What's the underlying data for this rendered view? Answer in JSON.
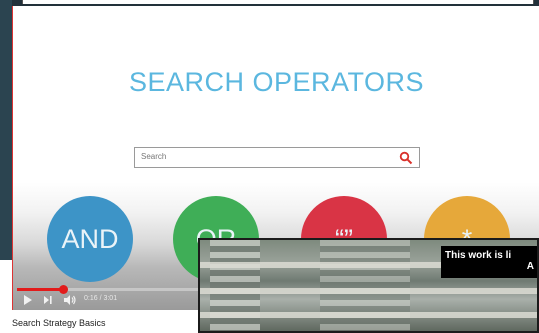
{
  "slide": {
    "title": "SEARCH OPERATORS",
    "search_placeholder": "Search",
    "operators": [
      "AND",
      "OR",
      "“”",
      "*"
    ]
  },
  "player": {
    "time": "0:16 / 3:01",
    "progress_fraction": 0.088
  },
  "video": {
    "title": "Search Strategy Basics"
  },
  "overlay": {
    "license_text": "This work is li",
    "license_text_2": "A"
  },
  "colors": {
    "title": "#5bb7df",
    "and": "#3d94c7",
    "or": "#3fae57",
    "quote": "#d93445",
    "star": "#e6a83a",
    "progress": "#e21b1b"
  }
}
